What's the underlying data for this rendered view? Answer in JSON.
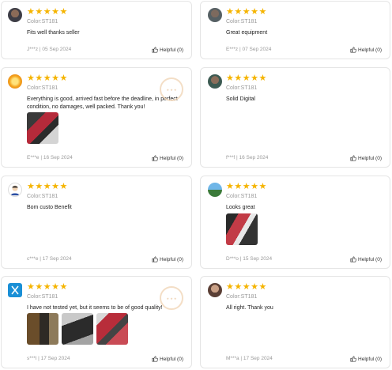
{
  "reviews": [
    {
      "variant": "Color:ST181",
      "text": "Fits well thanks seller",
      "footer": "J***z | 05 Sep 2024",
      "helpful": "Helpful (0)",
      "avatar": "man-photo-avatar"
    },
    {
      "variant": "Color:ST181",
      "text": "Great equipment",
      "footer": "E***z | 07 Sep 2024",
      "helpful": "Helpful (0)",
      "avatar": "man-photo-avatar"
    },
    {
      "variant": "Color:ST181",
      "text": "Everything is good, arrived fast before the deadline, in perfect condition, no damages, well packed. Thank you!",
      "footer": "E***e | 16 Sep 2024",
      "helpful": "Helpful (0)",
      "avatar": "sun-avatar"
    },
    {
      "variant": "Color:ST181",
      "text": "Solid Digital",
      "footer": "f***f | 16 Sep 2024",
      "helpful": "Helpful (0)",
      "avatar": "man-photo-avatar"
    },
    {
      "variant": "Color:ST181",
      "text": "Bom custo Benefit",
      "footer": "c***e | 17 Sep 2024",
      "helpful": "Helpful (0)",
      "avatar": "cartoon-avatar"
    },
    {
      "variant": "Color:ST181",
      "text": "Looks great",
      "footer": "D***o | 15 Sep 2024",
      "helpful": "Helpful (0)",
      "avatar": "landscape-avatar"
    },
    {
      "variant": "Color:ST181",
      "text": "I have not tested yet, but it seems to be of good quality!",
      "footer": "s***l | 17 Sep 2024",
      "helpful": "Helpful (0)",
      "avatar": "blue-logo-avatar"
    },
    {
      "variant": "Color:ST181",
      "text": "All right. Thank you",
      "footer": "M***a | 17 Sep 2024",
      "helpful": "Helpful (0)",
      "avatar": "man-photo-avatar"
    }
  ],
  "stars": "★★★★★",
  "colors": {
    "star": "#f5b400",
    "border": "#e5e5e5",
    "muted": "#999999"
  }
}
